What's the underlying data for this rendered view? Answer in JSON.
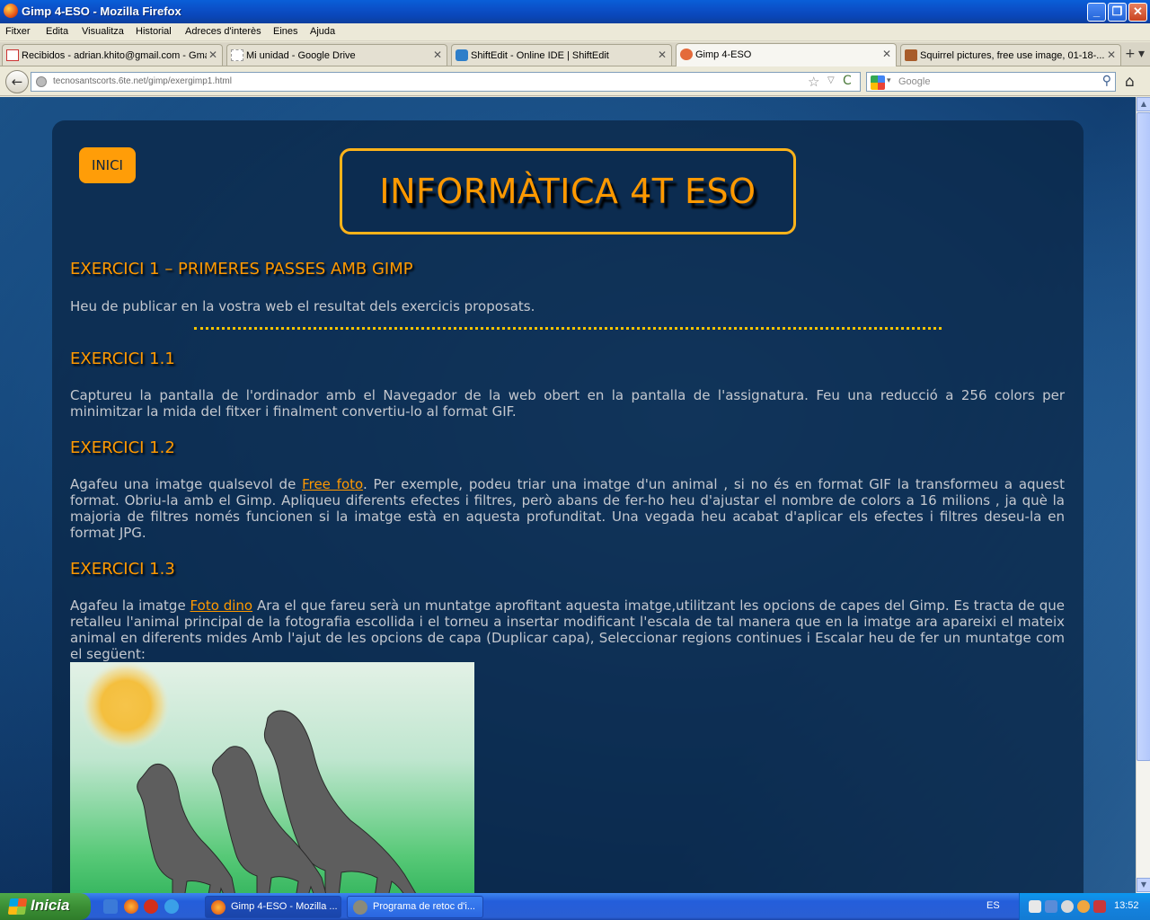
{
  "window": {
    "title": "Gimp 4-ESO - Mozilla Firefox",
    "min": "_",
    "max": "❐",
    "close": "✕"
  },
  "menu": [
    "Fitxer",
    "Edita",
    "Visualitza",
    "Historial",
    "Adreces d'interès",
    "Eines",
    "Ajuda"
  ],
  "tabs": [
    {
      "label": "Recibidos - adrian.khito@gmail.com - Gmail",
      "close": "✕"
    },
    {
      "label": "Mi unidad - Google Drive",
      "close": "✕"
    },
    {
      "label": "ShiftEdit - Online IDE | ShiftEdit",
      "close": "✕"
    },
    {
      "label": "Gimp 4-ESO",
      "close": "✕"
    },
    {
      "label": "Squirrel pictures, free use image, 01-18-...",
      "close": "✕"
    }
  ],
  "tab_new": "+",
  "tab_list": "▾",
  "nav": {
    "back": "←",
    "url": "tecnosantscorts.6te.net/gimp/exergimp1.html",
    "star": "☆",
    "dropdown": "▽",
    "reload": "C",
    "search_placeholder": "Google",
    "search_drop": "▾",
    "search_go": "⚲",
    "home": "⌂"
  },
  "page": {
    "inici": "INICI",
    "banner": "INFORMÀTICA 4T ESO",
    "h_main": "EXERCICI 1 – PRIMERES PASSES AMB GIMP",
    "intro": "Heu de publicar en la vostra web el resultat dels exercicis proposats.",
    "ex1": {
      "title": "EXERCICI 1.1",
      "text": "Captureu la pantalla de l'ordinador amb el Navegador de la web obert en la pantalla de l'assignatura. Feu una reducció a 256 colors per minimitzar la mida del fitxer i finalment convertiu-lo al format GIF."
    },
    "ex2": {
      "title": "EXERCICI 1.2",
      "text_before": "Agafeu una imatge qualsevol de ",
      "link": "Free foto",
      "text_after": ". Per exemple, podeu triar una imatge d'un animal , si no és en format GIF la transformeu a aquest format. Obriu-la amb el Gimp. Apliqueu diferents efectes i filtres, però abans de fer-ho heu d'ajustar el nombre de colors a 16 milions , ja què la majoria de filtres només funcionen si la imatge està en aquesta profunditat. Una vegada heu acabat d'aplicar els efectes i filtres deseu-la en format JPG."
    },
    "ex3": {
      "title": "EXERCICI 1.3",
      "text_before": "Agafeu la imatge ",
      "link": "Foto dino",
      "text_after": " Ara el que fareu serà un muntatge aprofitant aquesta imatge,utilitzant les opcions de capes del Gimp. Es tracta de que retalleu l'animal principal de la fotografia escollida i el torneu a insertar modificant l'escala de tal manera que en la imatge ara apareixi el mateix animal en diferents mides Amb l'ajut de les opcions de capa (Duplicar capa), Seleccionar regions continues i Escalar heu de fer un muntatge com el següent:"
    }
  },
  "scroll": {
    "up": "▲",
    "down": "▼"
  },
  "taskbar": {
    "start": "Inicia",
    "buttons": [
      {
        "label": "Gimp 4-ESO - Mozilla ..."
      },
      {
        "label": "Programa de retoc d'i..."
      }
    ],
    "lang": "ES",
    "clock": "13:52"
  },
  "colors": {
    "accent": "#ff9900",
    "page_bg": "#1a4f86",
    "panel": "#0a2646",
    "taskbar": "#245edb"
  }
}
